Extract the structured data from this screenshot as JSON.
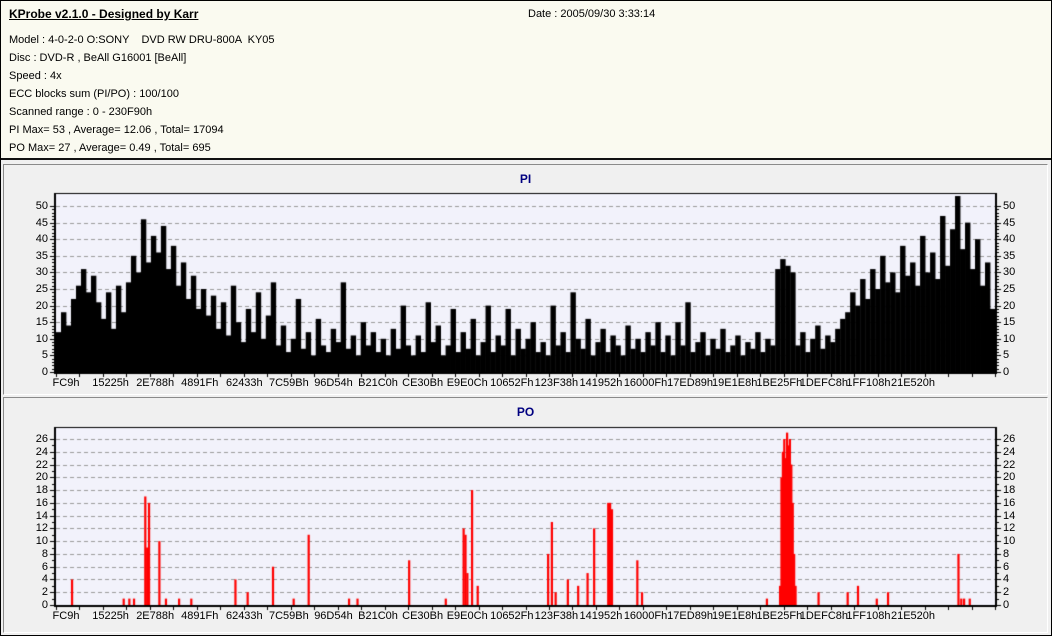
{
  "header": {
    "app_title": "KProbe v2.1.0 - Designed by Karr",
    "date_label": "Date : 2005/09/30 3:33:14",
    "info_lines": [
      "Model : 4-0-2-0 O:SONY    DVD RW DRU-800A  KY05",
      "Disc : DVD-R , BeAll G16001 [BeAll]",
      "Speed : 4x",
      "ECC blocks sum (PI/PO) : 100/100",
      "Scanned range : 0 - 230F90h",
      "PI Max= 53 , Average= 12.06 , Total= 17094",
      "PO Max= 27 , Average= 0.49 , Total= 695"
    ]
  },
  "chart_data": [
    {
      "type": "bar",
      "title": "PI",
      "color": "#000000",
      "plot_bg": "#F2F2FB",
      "grid": true,
      "ylim": [
        0,
        52
      ],
      "yticks": [
        0,
        5,
        10,
        15,
        20,
        25,
        30,
        35,
        40,
        45,
        50
      ],
      "x_labels": [
        "FC9h",
        "15225h",
        "2E788h",
        "4891Fh",
        "62433h",
        "7C59Bh",
        "96D54h",
        "B21C0h",
        "CE30Bh",
        "E9E0Ch",
        "10652Fh",
        "123F38h",
        "141952h",
        "16000Fh",
        "17ED89h",
        "19E1E8h",
        "1BE25Fh",
        "1DEFC8h",
        "1FF108h",
        "21E520h"
      ],
      "stats": {
        "max": 53,
        "average": 12.06,
        "total": 17094
      },
      "values": [
        12,
        18,
        14,
        22,
        26,
        31,
        24,
        29,
        21,
        16,
        24,
        13,
        26,
        18,
        27,
        35,
        30,
        46,
        33,
        41,
        36,
        44,
        31,
        38,
        26,
        33,
        22,
        29,
        19,
        25,
        17,
        23,
        13,
        21,
        11,
        26,
        15,
        9,
        19,
        12,
        24,
        10,
        17,
        27,
        8,
        14,
        6,
        10,
        22,
        7,
        12,
        5,
        16,
        8,
        6,
        13,
        9,
        27,
        7,
        11,
        5,
        15,
        8,
        12,
        6,
        10,
        5,
        13,
        7,
        20,
        8,
        5,
        11,
        6,
        21,
        9,
        14,
        5,
        8,
        19,
        6,
        12,
        7,
        16,
        5,
        9,
        20,
        6,
        11,
        8,
        19,
        5,
        13,
        7,
        10,
        15,
        6,
        9,
        5,
        20,
        8,
        12,
        6,
        24,
        10,
        7,
        16,
        5,
        9,
        13,
        6,
        11,
        8,
        5,
        14,
        7,
        10,
        6,
        12,
        8,
        15,
        6,
        11,
        5,
        15,
        8,
        21,
        6,
        9,
        12,
        5,
        10,
        7,
        13,
        6,
        8,
        11,
        5,
        9,
        7,
        12,
        6,
        10,
        8,
        31,
        34,
        32,
        30,
        8,
        12,
        6,
        10,
        14,
        7,
        11,
        9,
        13,
        16,
        18,
        24,
        20,
        28,
        22,
        31,
        25,
        35,
        27,
        30,
        24,
        38,
        29,
        33,
        26,
        41,
        30,
        36,
        28,
        47,
        32,
        43,
        53,
        37,
        45,
        31,
        40,
        26,
        33,
        19
      ]
    },
    {
      "type": "bar",
      "title": "PO",
      "color": "#FF0000",
      "plot_bg": "#F2F2FB",
      "grid": true,
      "ylim": [
        0,
        27
      ],
      "yticks": [
        0,
        2,
        4,
        6,
        8,
        10,
        12,
        14,
        16,
        18,
        20,
        22,
        24,
        26
      ],
      "x_labels": [
        "FC9h",
        "15225h",
        "2E788h",
        "4891Fh",
        "62433h",
        "7C59Bh",
        "96D54h",
        "B21C0h",
        "CE30Bh",
        "E9E0Ch",
        "10652Fh",
        "123F38h",
        "141952h",
        "16000Fh",
        "17ED89h",
        "19E1E8h",
        "1BE25Fh",
        "1DEFC8h",
        "1FF108h",
        "21E520h"
      ],
      "stats": {
        "max": 27,
        "average": 0.49,
        "total": 695
      },
      "spikes": [
        [
          0.017,
          4
        ],
        [
          0.072,
          1
        ],
        [
          0.078,
          1
        ],
        [
          0.083,
          1
        ],
        [
          0.095,
          17
        ],
        [
          0.097,
          9
        ],
        [
          0.099,
          16
        ],
        [
          0.11,
          10
        ],
        [
          0.117,
          1
        ],
        [
          0.131,
          1
        ],
        [
          0.144,
          1
        ],
        [
          0.191,
          4
        ],
        [
          0.204,
          2
        ],
        [
          0.231,
          6
        ],
        [
          0.253,
          1
        ],
        [
          0.269,
          11
        ],
        [
          0.312,
          1
        ],
        [
          0.321,
          1
        ],
        [
          0.376,
          7
        ],
        [
          0.415,
          1
        ],
        [
          0.434,
          12
        ],
        [
          0.436,
          11
        ],
        [
          0.438,
          5
        ],
        [
          0.443,
          18
        ],
        [
          0.449,
          3
        ],
        [
          0.524,
          8
        ],
        [
          0.528,
          13
        ],
        [
          0.532,
          2
        ],
        [
          0.545,
          4
        ],
        [
          0.556,
          3
        ],
        [
          0.566,
          5
        ],
        [
          0.573,
          12
        ],
        [
          0.588,
          16
        ],
        [
          0.59,
          16
        ],
        [
          0.592,
          15
        ],
        [
          0.619,
          7
        ],
        [
          0.624,
          2
        ],
        [
          0.757,
          1
        ],
        [
          0.771,
          3
        ],
        [
          0.7725,
          20
        ],
        [
          0.774,
          24
        ],
        [
          0.7755,
          26
        ],
        [
          0.777,
          23
        ],
        [
          0.7785,
          27
        ],
        [
          0.78,
          25
        ],
        [
          0.7815,
          26
        ],
        [
          0.783,
          22
        ],
        [
          0.7845,
          16
        ],
        [
          0.786,
          8
        ],
        [
          0.7875,
          3
        ],
        [
          0.812,
          2
        ],
        [
          0.843,
          2
        ],
        [
          0.854,
          3
        ],
        [
          0.874,
          1
        ],
        [
          0.886,
          2
        ],
        [
          0.961,
          8
        ],
        [
          0.964,
          1
        ],
        [
          0.967,
          1
        ],
        [
          0.973,
          1
        ]
      ]
    }
  ]
}
